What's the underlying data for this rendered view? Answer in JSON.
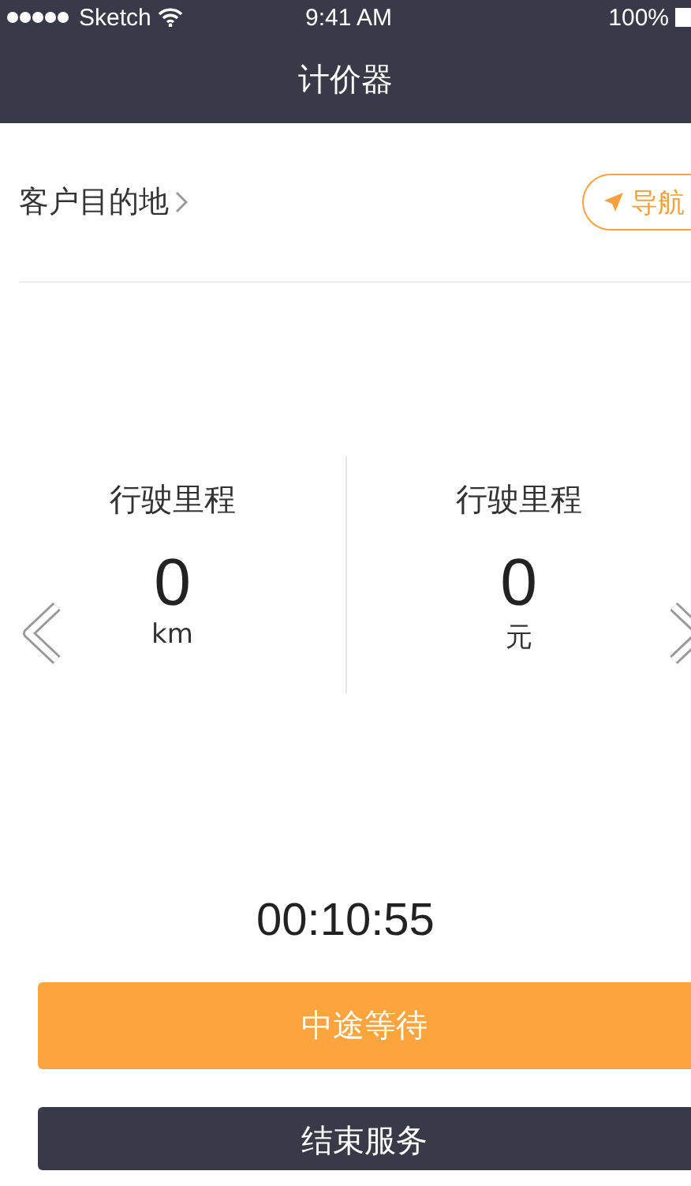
{
  "status_bar": {
    "carrier": "Sketch",
    "time": "9:41 AM",
    "battery": "100%"
  },
  "title": "计价器",
  "destination": {
    "label": "客户目的地",
    "nav_button": "导航"
  },
  "meters": [
    {
      "label": "行驶里程",
      "value": "0",
      "unit": "km"
    },
    {
      "label": "行驶里程",
      "value": "0",
      "unit": "元"
    }
  ],
  "timer": "00:10:55",
  "buttons": [
    {
      "label": "中途等待",
      "kind": "primary"
    },
    {
      "label": "结束服务",
      "kind": "secondary"
    }
  ]
}
